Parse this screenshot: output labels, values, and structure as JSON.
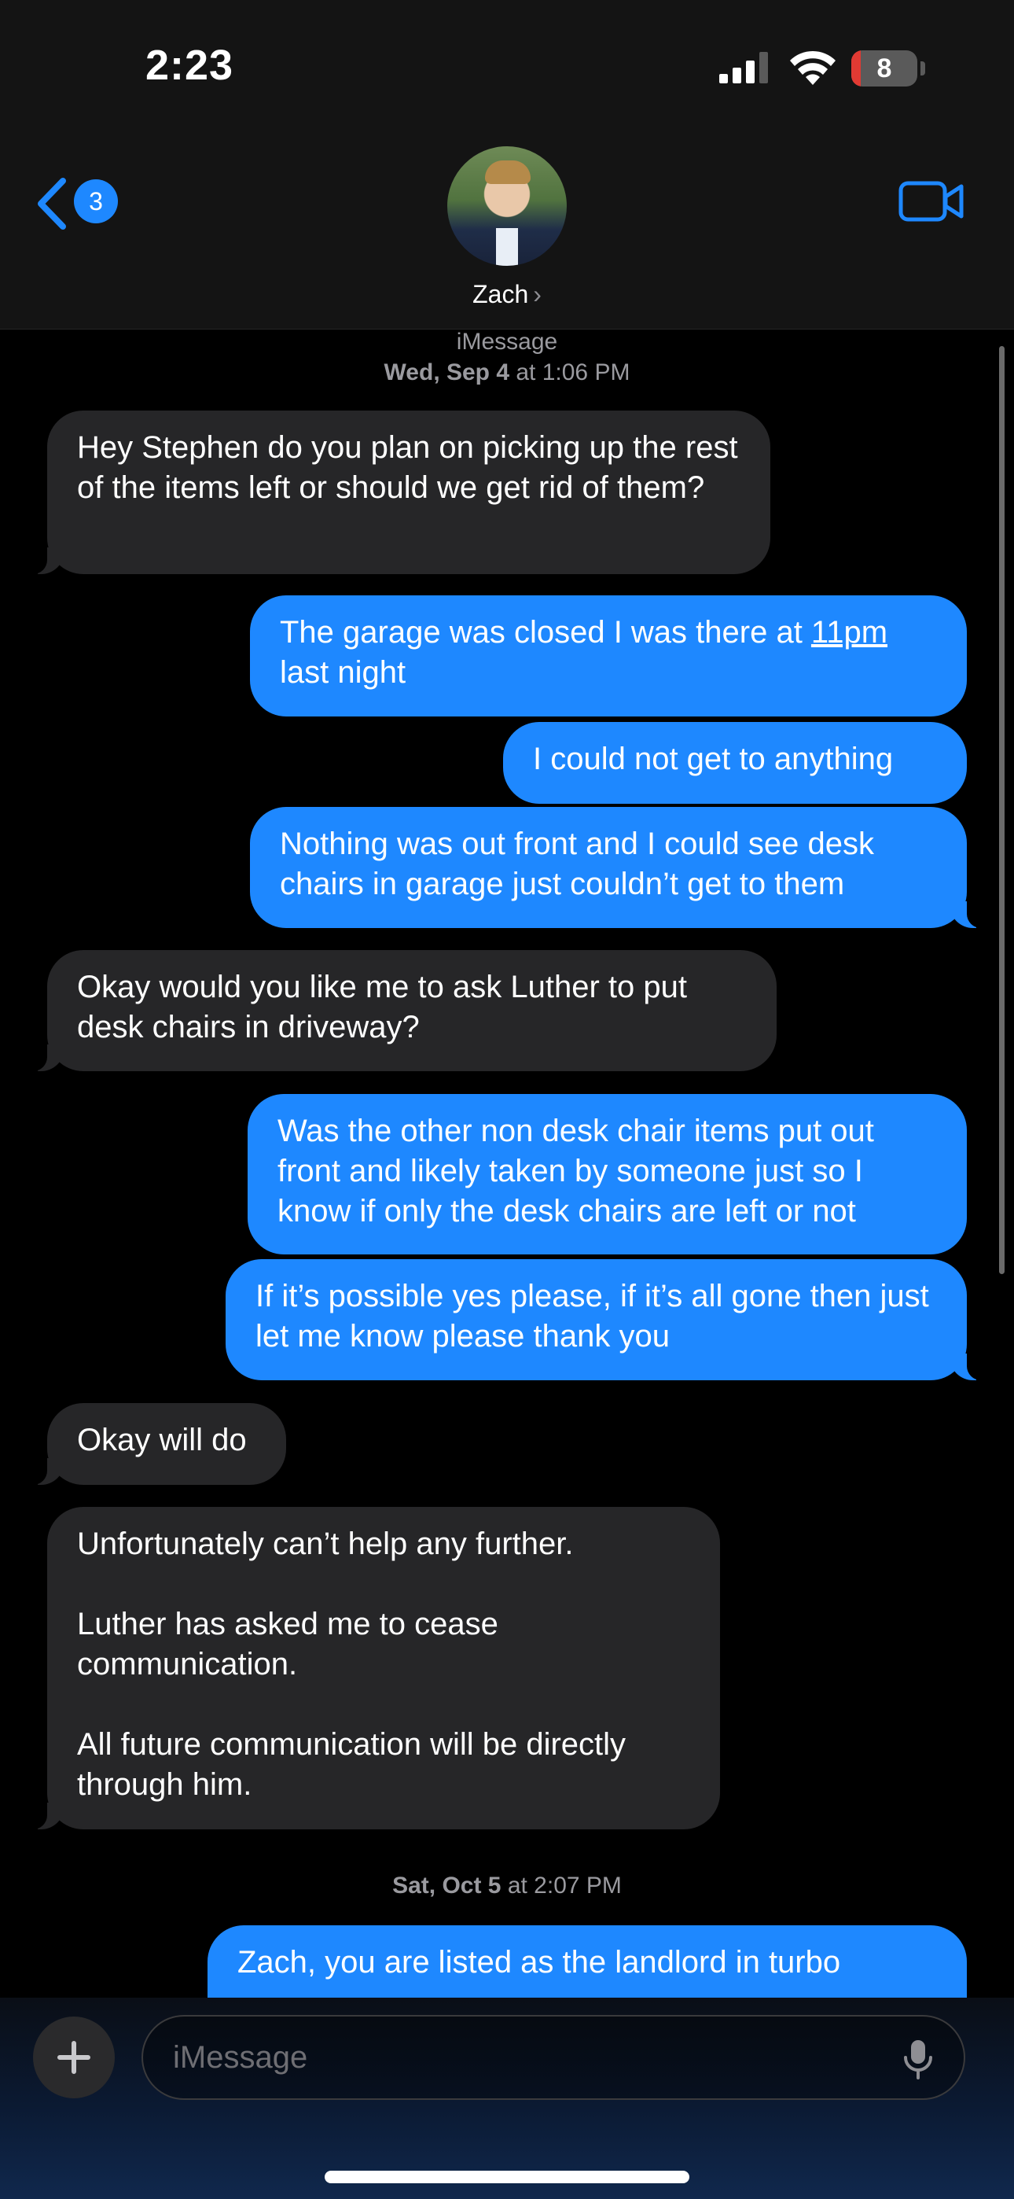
{
  "status_bar": {
    "time": "2:23",
    "battery": "8",
    "icons": [
      "signal-icon",
      "wifi-icon",
      "battery-icon"
    ]
  },
  "header": {
    "back_badge": "3",
    "contact_name": "Zach",
    "contact_chevron": "›",
    "icons": [
      "back-chevron-icon",
      "video-call-icon"
    ]
  },
  "thread": {
    "service_label": "iMessage",
    "timestamp1_day": "Wed, Sep 4",
    "timestamp1_rest": " at 1:06 PM",
    "timestamp2_day": "Sat, Oct 5",
    "timestamp2_rest": " at 2:07 PM",
    "messages": [
      {
        "from": "them",
        "text": "Hey Stephen do you plan on picking up the rest of the items left or should we get rid of them?"
      },
      {
        "from": "me",
        "text_before": "The garage was closed I was there at ",
        "link": "11pm",
        "text_after": " last night"
      },
      {
        "from": "me",
        "text": "I could not get to anything"
      },
      {
        "from": "me",
        "text": "Nothing was out front and I could see desk chairs in garage just couldn’t get to them"
      },
      {
        "from": "them",
        "text": "Okay would you like me to ask Luther to put desk chairs in driveway?"
      },
      {
        "from": "me",
        "text": "Was the other non desk chair items put out front and likely taken by someone just so I know if only the desk chairs are left or not"
      },
      {
        "from": "me",
        "text": "If it’s possible yes please, if it’s all gone then just let me know please thank you"
      },
      {
        "from": "them",
        "text": "Okay will do"
      },
      {
        "from": "them",
        "text": "Unfortunately can’t help any further.\n\nLuther has asked me to cease communication.\n\nAll future communication will be directly through him."
      },
      {
        "from": "me",
        "text": "Zach, you are listed as the landlord in turbo"
      }
    ]
  },
  "composer": {
    "placeholder": "iMessage",
    "icons": [
      "plus-icon",
      "microphone-icon"
    ]
  },
  "colors": {
    "outgoing": "#1e88ff",
    "incoming": "#262628",
    "accent": "#1e88ff"
  }
}
